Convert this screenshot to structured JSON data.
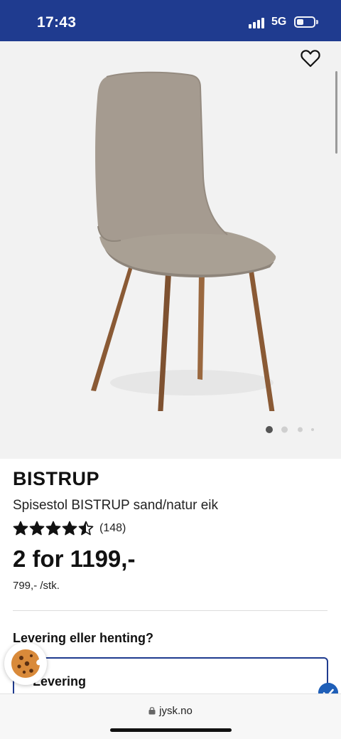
{
  "status_bar": {
    "time": "17:43",
    "network": "5G",
    "icons": [
      "signal-icon",
      "battery-icon"
    ]
  },
  "gallery": {
    "image": "chair-image",
    "favorite_icon": "heart-icon",
    "dots_total": 4,
    "active_dot": 0
  },
  "product": {
    "brand": "BISTRUP",
    "name": "Spisestol BISTRUP sand/natur eik",
    "rating": 4.5,
    "review_count": "(148)",
    "price": "2 for 1199,-",
    "unit_price": "799,- /stk."
  },
  "delivery": {
    "heading": "Levering eller henting?",
    "option_label": "Levering",
    "selected": true
  },
  "browser": {
    "url": "jysk.no"
  },
  "colors": {
    "brand_blue": "#1f3b8f",
    "check_blue": "#1f5fb8",
    "chair_fabric": "#a59b90",
    "chair_legs": "#8a5a35"
  }
}
